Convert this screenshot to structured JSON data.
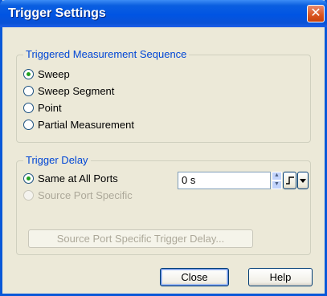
{
  "window": {
    "title": "Trigger Settings"
  },
  "title_close_glyph": "✕",
  "sequence_group": {
    "legend": "Triggered Measurement Sequence",
    "options": [
      "Sweep",
      "Sweep Segment",
      "Point",
      "Partial Measurement"
    ],
    "selected": "Sweep"
  },
  "delay_group": {
    "legend": "Trigger Delay",
    "option_same": "Same at All Ports",
    "option_specific": "Source Port Specific",
    "selected": "Same at All Ports",
    "delay_value": "0 s",
    "specific_button": "Source Port Specific Trigger Delay..."
  },
  "buttons": {
    "close": "Close",
    "help": "Help"
  },
  "icons": {
    "title_close": "close-icon",
    "spin": "spin-updown-icon",
    "step": "step-icon",
    "dropdown": "dropdown-arrow-icon"
  },
  "colors": {
    "titlebar": "#0054e3",
    "dialog_bg": "#ece9d8",
    "group_label": "#0046d5",
    "radio_dot": "#21a121"
  }
}
